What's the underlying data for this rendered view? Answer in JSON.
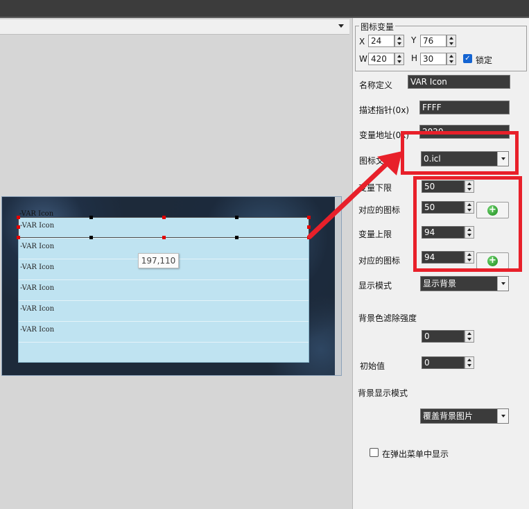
{
  "canvas": {
    "top_label": "-VAR Icon",
    "rows": [
      "-VAR Icon",
      "-VAR Icon",
      "-VAR Icon",
      "-VAR Icon",
      "-VAR Icon",
      "-VAR Icon"
    ],
    "tooltip": "197,110"
  },
  "props": {
    "group_title": "图标变量",
    "x_label": "X",
    "x_value": "24",
    "y_label": "Y",
    "y_value": "76",
    "w_label": "W",
    "w_value": "420",
    "h_label": "H",
    "h_value": "30",
    "lock_label": "锁定",
    "name_label": "名称定义",
    "name_value": "VAR Icon",
    "desc_label": "描述指针(0x)",
    "desc_value": "FFFF",
    "addr_label": "变量地址(0x)",
    "addr_value": "2020",
    "iconfile_label": "图标文件",
    "iconfile_value": "0.icl",
    "lower_label": "变量下限",
    "lower_value": "50",
    "icon1_label": "对应的图标",
    "icon1_value": "50",
    "upper_label": "变量上限",
    "upper_value": "94",
    "icon2_label": "对应的图标",
    "icon2_value": "94",
    "display_label": "显示模式",
    "display_value": "显示背景",
    "filter_label": "背景色滤除强度",
    "filter_value": "0",
    "init_label": "初始值",
    "init_value": "0",
    "bgmode_label": "背景显示模式",
    "bgmode_value": "覆盖背景图片",
    "popup_label": "在弹出菜单中显示"
  },
  "colors": {
    "highlight": "#e8202a",
    "list_bg": "#bfe3f1",
    "checkbox": "#1464d2"
  }
}
